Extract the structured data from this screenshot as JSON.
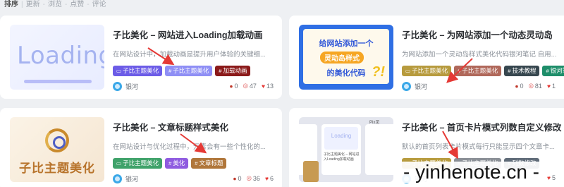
{
  "sort_bar": {
    "label": "排序",
    "options": [
      "更新",
      "浏览",
      "点赞",
      "评论"
    ]
  },
  "posts": [
    {
      "title": "子比美化 – 网站进入Loading加载动画",
      "excerpt": "在网站设计中，加载动画是提升用户体验的关键细...",
      "thumb_text": "Loading",
      "tags": [
        {
          "icon": "folder-icon",
          "label": "子比主题美化",
          "color": "#6c5ce7"
        },
        {
          "icon": "hash-icon",
          "label": "子比主题美化",
          "color": "#8f8ff5"
        },
        {
          "icon": "hash-icon",
          "label": "加载动画",
          "color": "#8b1a1a"
        }
      ],
      "author": "银河",
      "comments": "0",
      "views": "47",
      "likes": "13"
    },
    {
      "title": "子比美化 – 为网站添加一个动态灵动岛",
      "excerpt": "为网站添加一个灵动岛样式美化代码银河笔记 自用...",
      "thumb_lines": [
        "给网站添加一个",
        "灵动岛样式",
        "的美化代码"
      ],
      "thumb_mark": "?!",
      "tags": [
        {
          "icon": "folder-icon",
          "label": "子比主题美化",
          "color": "#b79b3e"
        },
        {
          "icon": "hash-icon",
          "label": "子比主题美化",
          "color": "#b0685a"
        },
        {
          "icon": "hash-icon",
          "label": "技术教程",
          "color": "#37474f"
        },
        {
          "icon": "hash-icon",
          "label": "银河笔",
          "color": "#1e8e6a"
        }
      ],
      "author": "银河",
      "comments": "0",
      "views": "81",
      "likes": "1"
    },
    {
      "title": "子比美化 – 文章标题样式美化",
      "excerpt": "在网站设计与优化过程中，元素会有一些个性化的...",
      "thumb_text": "子比主题美化",
      "tags": [
        {
          "icon": "folder-icon",
          "label": "子比主题美化",
          "color": "#3fa26a"
        },
        {
          "icon": "hash-icon",
          "label": "美化",
          "color": "#8f5be0"
        },
        {
          "icon": "hash-icon",
          "label": "文章标题",
          "color": "#b0763a"
        }
      ],
      "author": "银河",
      "comments": "0",
      "views": "36",
      "likes": "6"
    },
    {
      "title": "子比美化 – 首页卡片模式列数自定义修改",
      "excerpt": "默认的首页列表卡片模式每行只能显示四个文章卡...",
      "thumb_text": "Loading",
      "thumb_caption": "子比主题美化 – 网站进入Loading加载动画",
      "thumb_label": "Pix见",
      "tags": [
        {
          "icon": "folder-icon",
          "label": "子比主题美化",
          "color": "#b79b3e"
        },
        {
          "icon": "hash-icon",
          "label": "子比主题美化",
          "color": "#8a8f96"
        },
        {
          "icon": "hash-icon",
          "label": "列数修改",
          "color": "#5f6b78"
        }
      ],
      "author": "银河",
      "comments": "",
      "views": "",
      "likes": "5"
    }
  ],
  "watermark": "- yinhenote.cn -",
  "colors": {
    "background": "#eef0f3",
    "arrow": "#e53935",
    "card": "#ffffff"
  }
}
